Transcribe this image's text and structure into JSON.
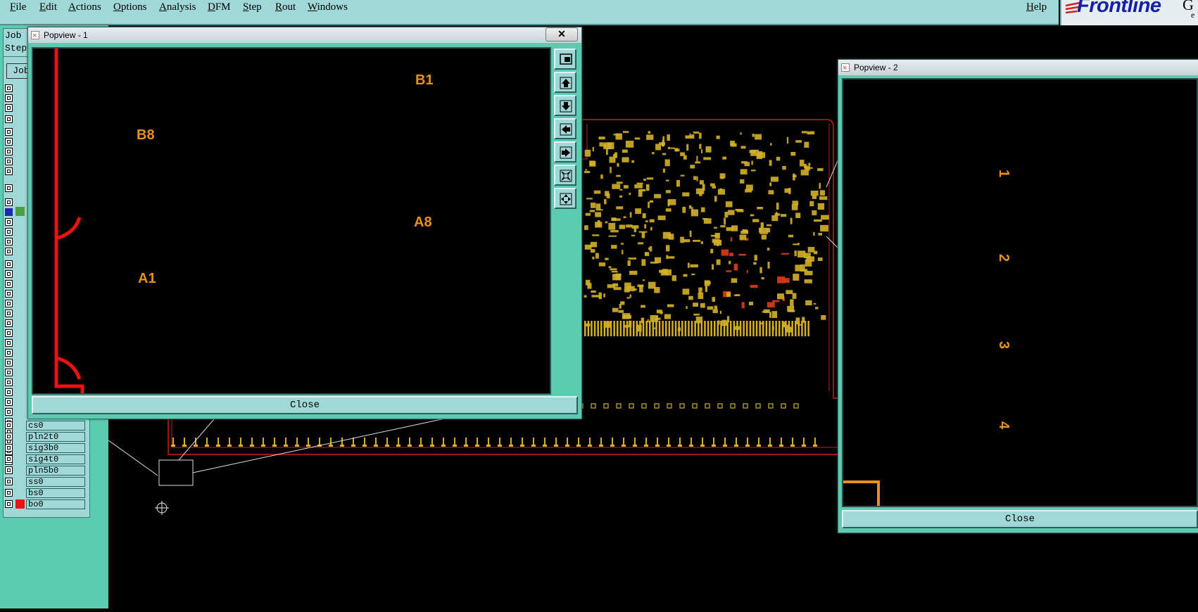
{
  "menubar": {
    "items": [
      "File",
      "Edit",
      "Actions",
      "Options",
      "Analysis",
      "DFM",
      "Step",
      "Rout",
      "Windows"
    ],
    "help": "Help"
  },
  "logo": {
    "text": "Frontline",
    "extra": "G",
    "extra2": "e"
  },
  "left_panel": {
    "job_label": "Job",
    "step_label": "Step",
    "job_button": "Job",
    "layers": [
      {
        "name": "cs0",
        "color": ""
      },
      {
        "name": "pln2t0",
        "color": ""
      },
      {
        "name": "sig3b0",
        "color": ""
      },
      {
        "name": "sig4t0",
        "color": ""
      },
      {
        "name": "pln5b0",
        "color": ""
      },
      {
        "name": "ss0",
        "color": ""
      },
      {
        "name": "bs0",
        "color": ""
      },
      {
        "name": "bo0",
        "color": "#ee1111"
      }
    ]
  },
  "popview1": {
    "title": "Popview - 1",
    "close_x": "✕",
    "close_label": "Close",
    "pins": [
      "B1",
      "B8",
      "A8",
      "A1"
    ],
    "tools": [
      "zoom-fit-icon",
      "pan-up-icon",
      "pan-down-icon",
      "pan-left-icon",
      "pan-right-icon",
      "zoom-out-icon",
      "zoom-in-icon"
    ]
  },
  "popview2": {
    "title": "Popview - 2",
    "close_label": "Close",
    "pins": [
      "1",
      "2",
      "3",
      "4"
    ]
  },
  "colors": {
    "panel": "#5cccb0",
    "panel_light": "#a0d8d8",
    "trace_red": "#cc1a1a",
    "pad_yellow": "#d4b028",
    "pin_orange": "#e8901a",
    "logo_blue": "#1520a6"
  }
}
